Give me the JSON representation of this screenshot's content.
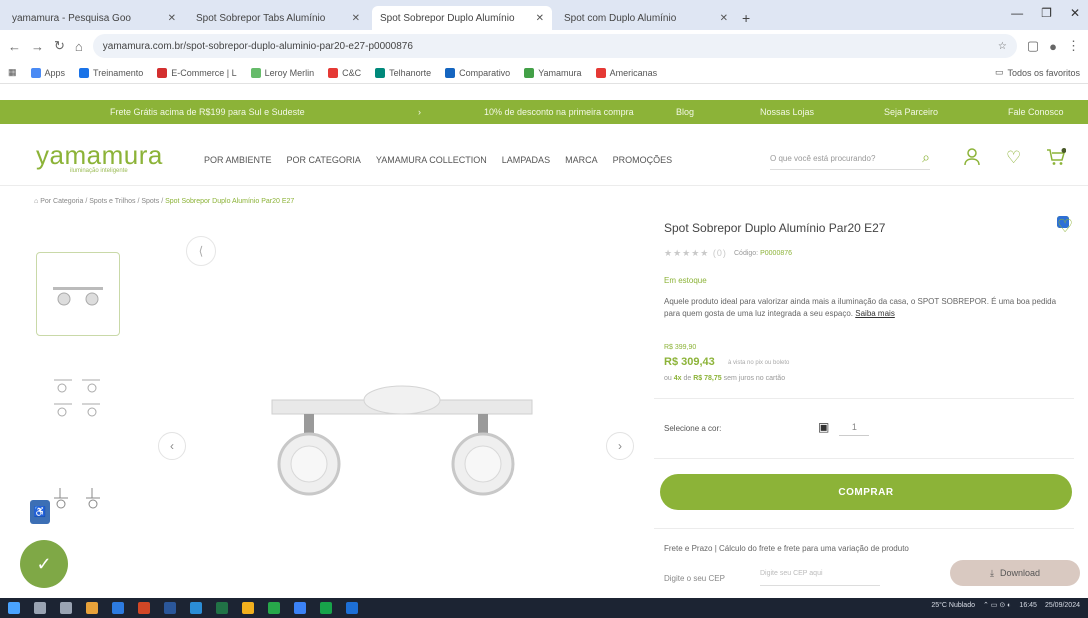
{
  "browser": {
    "tabs": [
      {
        "title": "yamamura - Pesquisa Goo",
        "color": "#4a8af4",
        "active": false
      },
      {
        "title": "Spot Sobrepor Tabs Alumínio",
        "color": "#8cb338",
        "active": false
      },
      {
        "title": "Spot Sobrepor Duplo Alumínio",
        "color": "#8cb338",
        "active": true
      },
      {
        "title": "Spot com Duplo Alumínio",
        "color": "#2d6fd6",
        "active": false
      }
    ],
    "new_tab": "+",
    "window_controls": [
      "—",
      "❐",
      "✕"
    ],
    "url": "yamamura.com.br/spot-sobrepor-duplo-aluminio-par20-e27-p0000876",
    "bookmarks": [
      {
        "label": "Apps",
        "color": "#4a8af4"
      },
      {
        "label": "Treinamento",
        "color": "#1a73e8"
      },
      {
        "label": "E-Commerce | L",
        "color": "#d32f2f"
      },
      {
        "label": "Leroy Merlin",
        "color": "#66bb6a"
      },
      {
        "label": "C&C",
        "color": "#e53935"
      },
      {
        "label": "Telhanorte",
        "color": "#00897b"
      },
      {
        "label": "Comparativo",
        "color": "#1565c0"
      },
      {
        "label": "Yamamura",
        "color": "#43a047"
      },
      {
        "label": "Americanas",
        "color": "#e53935"
      }
    ],
    "bookmarks_all": "Todos os favoritos"
  },
  "promo_bar": {
    "items": [
      "Frete Grátis acima de R$199 para Sul e Sudeste",
      "10% de desconto na primeira compra",
      "Blog",
      "Nossas Lojas",
      "Seja Parceiro",
      "Fale Conosco"
    ]
  },
  "header": {
    "logo": "yamamura",
    "logo_tagline": "iluminação inteligente",
    "menu": [
      "POR AMBIENTE",
      "POR CATEGORIA",
      "YAMAMURA COLLECTION",
      "LAMPADAS",
      "MARCA",
      "PROMOÇÕES"
    ],
    "search_placeholder": "O que você está procurando?"
  },
  "breadcrumb": {
    "path": "Por Categoria / Spots e Trilhos / Spots / ",
    "current": "Spot Sobrepor Duplo Alumínio Par20 E27"
  },
  "product": {
    "title": "Spot Sobrepor Duplo Alumínio Par20 E27",
    "stars": "★★★★★",
    "rating_count": "(0)",
    "code_label": "Código:",
    "code": "P0000876",
    "stock": "Em estoque",
    "description": "Aquele produto ideal para valorizar ainda mais a iluminação da casa, o SPOT SOBREPOR. É uma boa pedida para quem gosta de uma luz integrada a seu espaço.",
    "read_more": "Saiba mais",
    "old_price": "R$ 399,90",
    "price": "R$ 309,43",
    "price_note": "à vista no pix ou boleto",
    "installments_prefix": "ou",
    "installments_count": "4x",
    "installments_of": "de",
    "installments_value": "R$ 78,75",
    "installments_suffix": "sem juros no cartão",
    "qty_label": "Selecione a cor:",
    "qty_value": "1",
    "buy_label": "COMPRAR",
    "freight_text": "Frete e Prazo | Cálculo do frete e frete para uma variação de produto",
    "cep_label": "Digite o seu CEP",
    "cep_placeholder": "Digite seu CEP aqui"
  },
  "download_label": "Download",
  "taskbar": {
    "weather": "25°C Nublado",
    "time": "16:45",
    "date": "25/09/2024"
  },
  "colors": {
    "brand": "#8cb338"
  }
}
